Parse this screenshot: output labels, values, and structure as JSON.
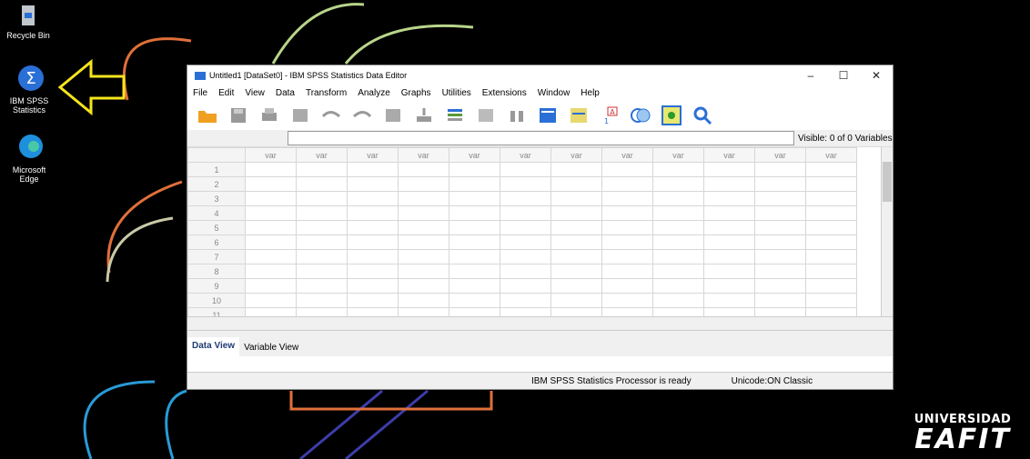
{
  "desktop": {
    "icons": [
      {
        "label": "Recycle Bin"
      },
      {
        "label": "IBM SPSS Statistics"
      },
      {
        "label": "Microsoft Edge"
      }
    ]
  },
  "window": {
    "title": "Untitled1 [DataSet0] - IBM SPSS Statistics Data Editor",
    "menu": [
      "File",
      "Edit",
      "View",
      "Data",
      "Transform",
      "Analyze",
      "Graphs",
      "Utilities",
      "Extensions",
      "Window",
      "Help"
    ],
    "visible_text": "Visible: 0 of 0 Variables",
    "column_header": "var",
    "row_numbers": [
      "1",
      "2",
      "3",
      "4",
      "5",
      "6",
      "7",
      "8",
      "9",
      "10",
      "11"
    ],
    "tabs": [
      "Data View",
      "Variable View"
    ],
    "status": {
      "processor": "IBM SPSS Statistics Processor is ready",
      "unicode": "Unicode:ON Classic"
    }
  },
  "brand": {
    "line1": "UNIVERSIDAD",
    "line2": "EAFIT"
  },
  "colors": {
    "accent": "#2a6fd6",
    "arrow": "#f5e51c"
  }
}
